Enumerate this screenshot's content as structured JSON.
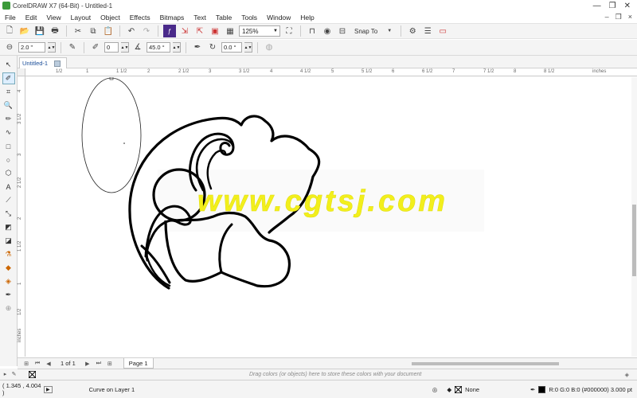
{
  "window": {
    "title": "CorelDRAW X7 (64-Bit) - Untitled-1",
    "controls": [
      "—",
      "❐",
      "✕"
    ]
  },
  "menu": [
    "File",
    "Edit",
    "View",
    "Layout",
    "Object",
    "Effects",
    "Bitmaps",
    "Text",
    "Table",
    "Tools",
    "Window",
    "Help"
  ],
  "toolbar": {
    "zoom": "125%",
    "snap": "Snap To"
  },
  "propertybar": {
    "outline_width": "2.0 \"",
    "nib": "0",
    "angle": "45.0 °",
    "rotation": "0.0 °"
  },
  "document": {
    "tab": "Untitled-1"
  },
  "ruler": {
    "h_labels": [
      "1/2",
      "1",
      "1 1/2",
      "2",
      "2 1/2",
      "3",
      "3 1/2",
      "4",
      "4 1/2",
      "5",
      "5 1/2",
      "6",
      "6 1/2",
      "7",
      "7 1/2",
      "8",
      "8 1/2",
      "inches"
    ],
    "v_labels": [
      "4",
      "3 1/2",
      "3",
      "2 1/2",
      "2",
      "1 1/2",
      "1",
      "1/2",
      "inches"
    ]
  },
  "canvas": {
    "watermark": "www.cgtsj.com",
    "watermark_color": "#f2ef1c"
  },
  "pagenav": {
    "counter": "1 of 1",
    "page_tab": "Page 1"
  },
  "palette": {
    "hint": "Drag colors (or objects) here to store these colors with your document"
  },
  "status": {
    "coords": "( 1.345 , 4.004 )",
    "info": "Curve on Layer 1",
    "fill": "None",
    "outline": "R:0 G:0 B:0 (#000000)  3.000 pt"
  }
}
